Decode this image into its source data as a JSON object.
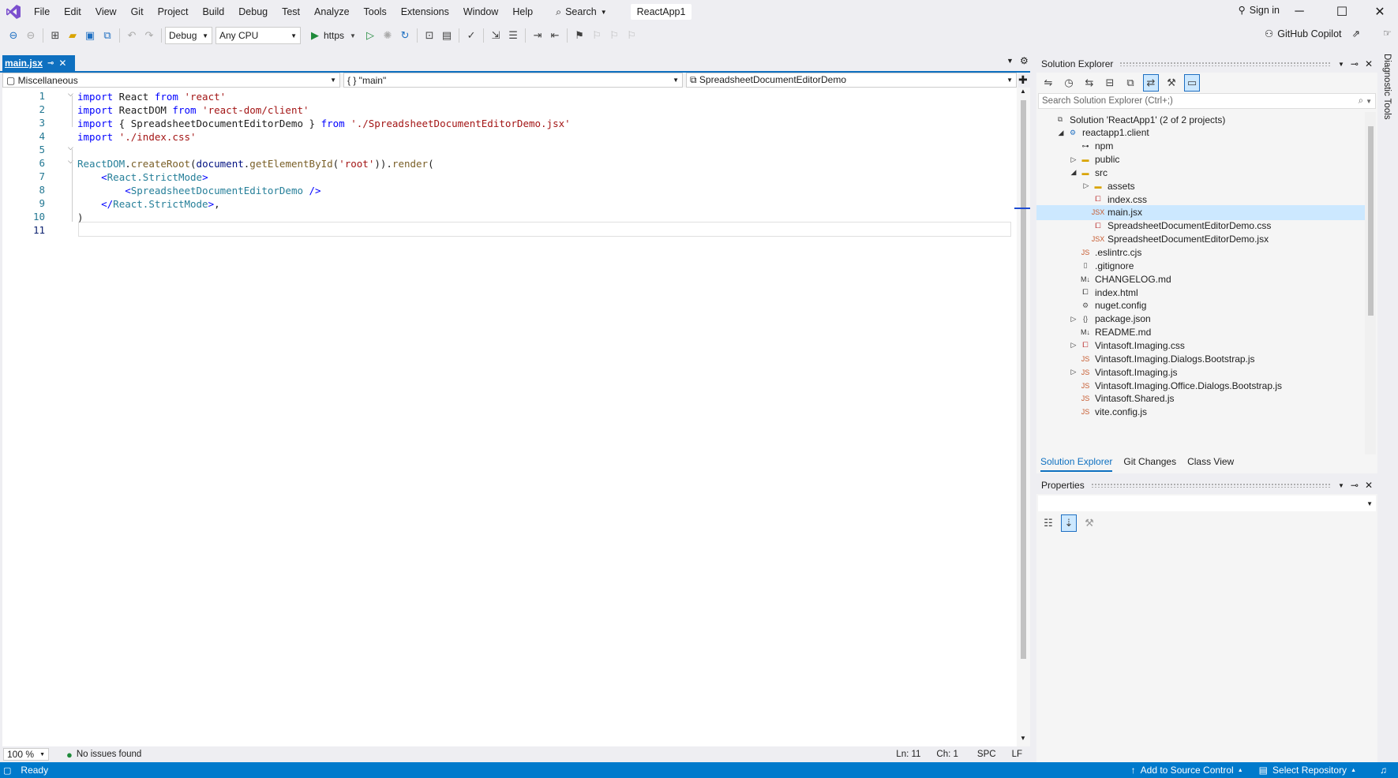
{
  "menubar": {
    "items": [
      "File",
      "Edit",
      "View",
      "Git",
      "Project",
      "Build",
      "Debug",
      "Test",
      "Analyze",
      "Tools",
      "Extensions",
      "Window",
      "Help"
    ],
    "search": "Search",
    "title": "ReactApp1",
    "sign_in": "Sign in"
  },
  "toolbar": {
    "config": "Debug",
    "platform": "Any CPU",
    "run_target": "https",
    "copilot": "GitHub Copilot"
  },
  "editor": {
    "tab": "main.jsx",
    "nav": {
      "project": "Miscellaneous",
      "scope": "{ } \"main\"",
      "member": "SpreadsheetDocumentEditorDemo"
    },
    "line_numbers": [
      "1",
      "2",
      "3",
      "4",
      "5",
      "6",
      "7",
      "8",
      "9",
      "10",
      "11"
    ],
    "zoom": "100 %",
    "issues": "No issues found",
    "ln": "Ln: 11",
    "ch": "Ch: 1",
    "spc": "SPC",
    "lf": "LF"
  },
  "solution_explorer": {
    "title": "Solution Explorer",
    "search_placeholder": "Search Solution Explorer (Ctrl+;)",
    "items": [
      {
        "label": "Solution 'ReactApp1' (2 of 2 projects)",
        "icon": "solution-icon",
        "level": 0,
        "exp": ""
      },
      {
        "label": "reactapp1.client",
        "icon": "project-icon",
        "level": 1,
        "exp": "◢"
      },
      {
        "label": "npm",
        "icon": "npm-icon",
        "level": 2,
        "exp": ""
      },
      {
        "label": "public",
        "icon": "folder-icon",
        "level": 2,
        "exp": "▷"
      },
      {
        "label": "src",
        "icon": "folder-icon",
        "level": 2,
        "exp": "◢"
      },
      {
        "label": "assets",
        "icon": "folder-icon",
        "level": 3,
        "exp": "▷"
      },
      {
        "label": "index.css",
        "icon": "css-icon",
        "level": 3,
        "exp": ""
      },
      {
        "label": "main.jsx",
        "icon": "jsx-icon",
        "level": 3,
        "exp": "",
        "selected": true
      },
      {
        "label": "SpreadsheetDocumentEditorDemo.css",
        "icon": "css-icon",
        "level": 3,
        "exp": ""
      },
      {
        "label": "SpreadsheetDocumentEditorDemo.jsx",
        "icon": "jsx-icon",
        "level": 3,
        "exp": ""
      },
      {
        "label": ".eslintrc.cjs",
        "icon": "js-icon",
        "level": 2,
        "exp": ""
      },
      {
        "label": ".gitignore",
        "icon": "file-icon",
        "level": 2,
        "exp": ""
      },
      {
        "label": "CHANGELOG.md",
        "icon": "md-icon",
        "level": 2,
        "exp": ""
      },
      {
        "label": "index.html",
        "icon": "html-icon",
        "level": 2,
        "exp": ""
      },
      {
        "label": "nuget.config",
        "icon": "config-icon",
        "level": 2,
        "exp": ""
      },
      {
        "label": "package.json",
        "icon": "json-icon",
        "level": 2,
        "exp": "▷"
      },
      {
        "label": "README.md",
        "icon": "md-icon",
        "level": 2,
        "exp": ""
      },
      {
        "label": "Vintasoft.Imaging.css",
        "icon": "css-icon",
        "level": 2,
        "exp": "▷"
      },
      {
        "label": "Vintasoft.Imaging.Dialogs.Bootstrap.js",
        "icon": "js-icon",
        "level": 2,
        "exp": ""
      },
      {
        "label": "Vintasoft.Imaging.js",
        "icon": "js-icon",
        "level": 2,
        "exp": "▷"
      },
      {
        "label": "Vintasoft.Imaging.Office.Dialogs.Bootstrap.js",
        "icon": "js-icon",
        "level": 2,
        "exp": ""
      },
      {
        "label": "Vintasoft.Shared.js",
        "icon": "js-icon",
        "level": 2,
        "exp": ""
      },
      {
        "label": "vite.config.js",
        "icon": "js-icon",
        "level": 2,
        "exp": ""
      }
    ],
    "tabs": [
      "Solution Explorer",
      "Git Changes",
      "Class View"
    ]
  },
  "properties": {
    "title": "Properties"
  },
  "diagnostic": {
    "label": "Diagnostic Tools"
  },
  "statusbar": {
    "ready": "Ready",
    "source_control": "Add to Source Control",
    "repository": "Select Repository"
  },
  "colors": {
    "accent": "#007acc",
    "tab": "#0e70c0",
    "keyword": "#0000ff",
    "string": "#a31515",
    "tag": "#267f99"
  }
}
